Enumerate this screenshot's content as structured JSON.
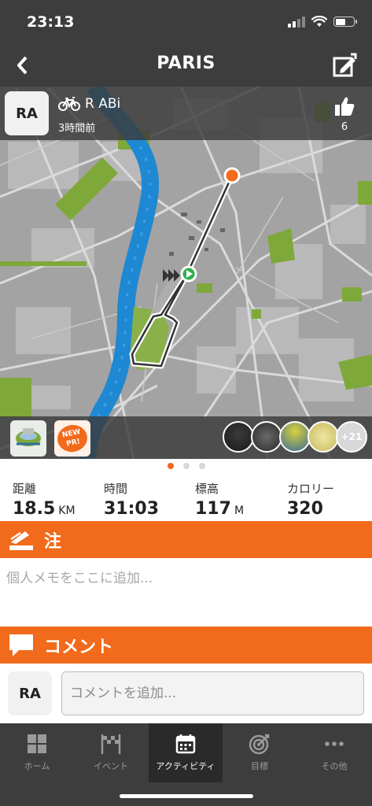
{
  "status_bar": {
    "time": "23:13"
  },
  "nav": {
    "title": "PARIS"
  },
  "activity": {
    "avatar_initials": "RA",
    "rider_name": "R  ABi",
    "time_ago": "3時間前",
    "likes": "6"
  },
  "badges": {
    "new_pr_text": "NEW PR!"
  },
  "riders_more": "+21",
  "page_indicator": {
    "total": 3,
    "active": 0
  },
  "stats": {
    "distance": {
      "label": "距離",
      "value": "18.5",
      "unit": "KM"
    },
    "time": {
      "label": "時間",
      "value": "31:03"
    },
    "elevation": {
      "label": "標高",
      "value": "117",
      "unit": "M"
    },
    "calories": {
      "label": "カロリー",
      "value": "320"
    }
  },
  "notes": {
    "title": "注",
    "placeholder": "個人メモをここに追加..."
  },
  "comments": {
    "title": "コメント",
    "avatar_initials": "RA",
    "placeholder": "コメントを追加..."
  },
  "tabs": [
    {
      "label": "ホーム",
      "icon": "home-grid-icon"
    },
    {
      "label": "イベント",
      "icon": "checkered-flag-icon"
    },
    {
      "label": "アクティビティ",
      "icon": "calendar-icon"
    },
    {
      "label": "目標",
      "icon": "target-icon"
    },
    {
      "label": "その他",
      "icon": "more-dots-icon"
    }
  ],
  "colors": {
    "accent": "#f26a1b",
    "bar": "#3d3d3d",
    "map_river": "#1e88d2",
    "map_park": "#7fa83a",
    "route_start": "#2eae4b",
    "route_end": "#f26a1b"
  }
}
